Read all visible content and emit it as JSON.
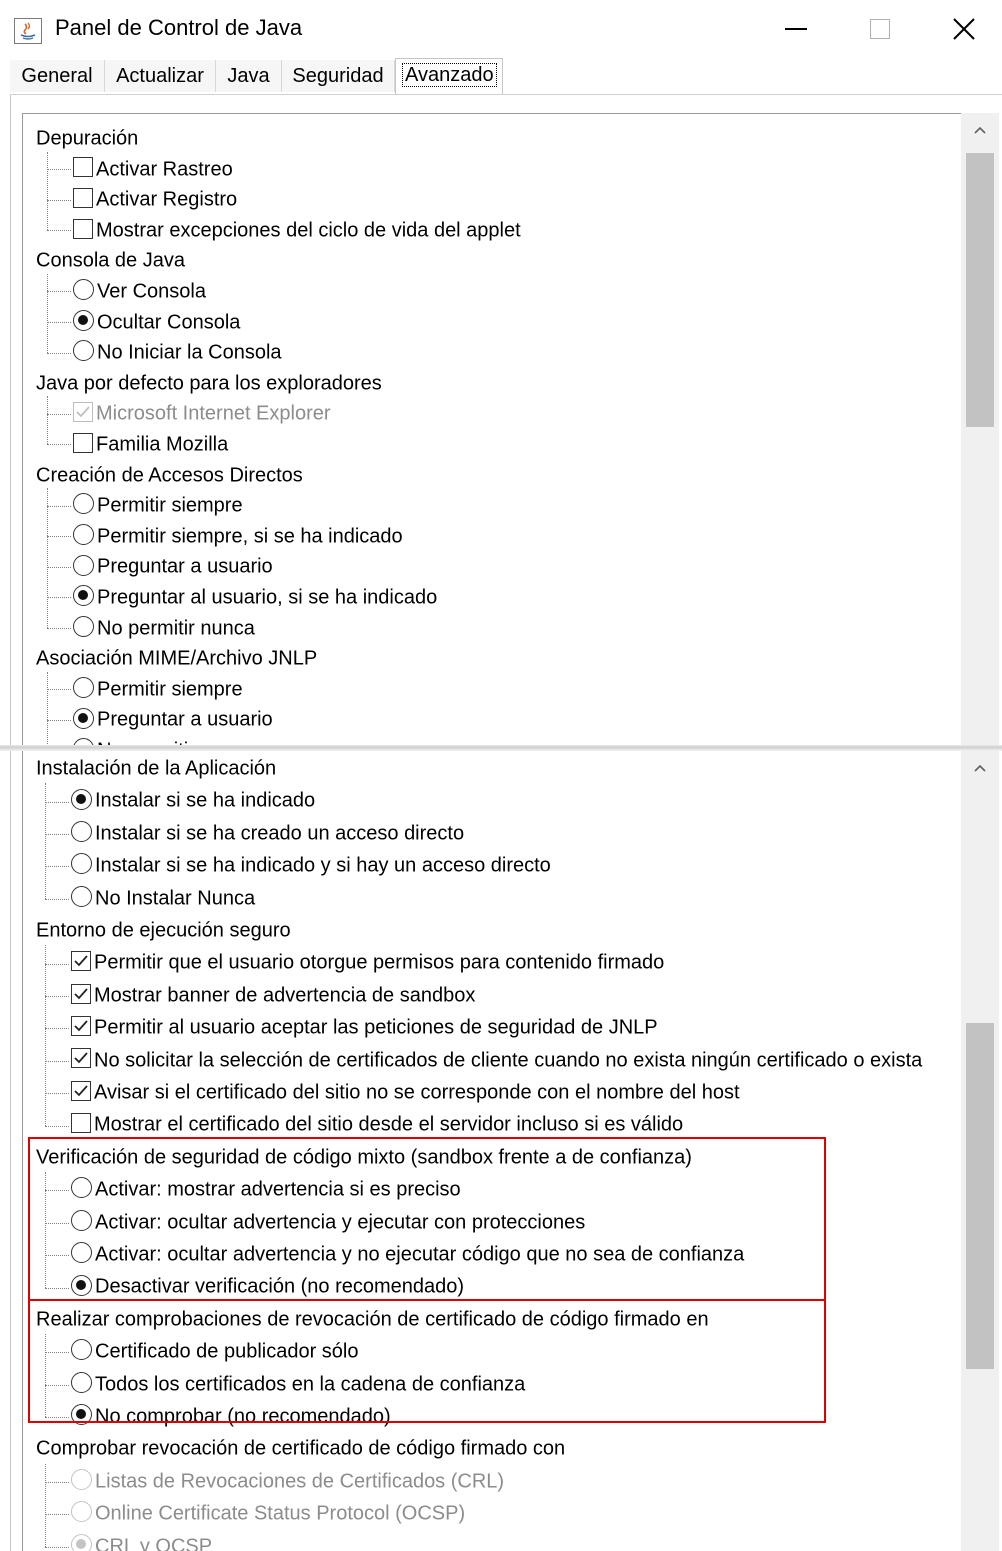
{
  "window": {
    "title": "Panel de Control de Java",
    "accent_color": "#e00000"
  },
  "tabs": [
    {
      "label": "General"
    },
    {
      "label": "Actualizar"
    },
    {
      "label": "Java"
    },
    {
      "label": "Seguridad"
    },
    {
      "label": "Avanzado"
    }
  ],
  "active_tab": "Avanzado",
  "top_panel": {
    "sections": [
      {
        "title": "Depuración",
        "items": [
          {
            "label": "Activar Rastreo",
            "type": "checkbox",
            "checked": false
          },
          {
            "label": "Activar Registro",
            "type": "checkbox",
            "checked": false
          },
          {
            "label": "Mostrar excepciones del ciclo de vida del applet",
            "type": "checkbox",
            "checked": false
          }
        ]
      },
      {
        "title": "Consola de Java",
        "items": [
          {
            "label": "Ver Consola",
            "type": "radio",
            "checked": false
          },
          {
            "label": "Ocultar Consola",
            "type": "radio",
            "checked": true
          },
          {
            "label": "No Iniciar la Consola",
            "type": "radio",
            "checked": false
          }
        ]
      },
      {
        "title": "Java por defecto para los exploradores",
        "items": [
          {
            "label": "Microsoft Internet Explorer",
            "type": "checkbox",
            "checked": true,
            "disabled": true
          },
          {
            "label": "Familia Mozilla",
            "type": "checkbox",
            "checked": false
          }
        ]
      },
      {
        "title": "Creación de Accesos Directos",
        "items": [
          {
            "label": "Permitir siempre",
            "type": "radio",
            "checked": false
          },
          {
            "label": "Permitir siempre, si se ha indicado",
            "type": "radio",
            "checked": false
          },
          {
            "label": "Preguntar a usuario",
            "type": "radio",
            "checked": false
          },
          {
            "label": "Preguntar al usuario, si se ha indicado",
            "type": "radio",
            "checked": true
          },
          {
            "label": "No permitir nunca",
            "type": "radio",
            "checked": false
          }
        ]
      },
      {
        "title": "Asociación MIME/Archivo JNLP",
        "items": [
          {
            "label": "Permitir siempre",
            "type": "radio",
            "checked": false
          },
          {
            "label": "Preguntar a usuario",
            "type": "radio",
            "checked": true
          },
          {
            "label": "No permitir nunca",
            "type": "radio",
            "checked": false
          }
        ]
      }
    ]
  },
  "bottom_panel": {
    "sections": [
      {
        "title": "Instalación de la Aplicación",
        "items": [
          {
            "label": "Instalar si se ha indicado",
            "type": "radio",
            "checked": true
          },
          {
            "label": "Instalar si se ha creado un acceso directo",
            "type": "radio",
            "checked": false
          },
          {
            "label": "Instalar si se ha indicado y si hay un acceso directo",
            "type": "radio",
            "checked": false
          },
          {
            "label": "No Instalar Nunca",
            "type": "radio",
            "checked": false
          }
        ]
      },
      {
        "title": "Entorno de ejecución seguro",
        "items": [
          {
            "label": "Permitir que el usuario otorgue permisos para contenido firmado",
            "type": "checkbox",
            "checked": true
          },
          {
            "label": "Mostrar banner de advertencia de sandbox",
            "type": "checkbox",
            "checked": true
          },
          {
            "label": "Permitir al usuario aceptar las peticiones de seguridad de JNLP",
            "type": "checkbox",
            "checked": true
          },
          {
            "label": "No solicitar la selección de certificados de cliente cuando no exista ningún certificado o exista",
            "type": "checkbox",
            "checked": true
          },
          {
            "label": "Avisar si el certificado del sitio no se corresponde con el nombre del host",
            "type": "checkbox",
            "checked": true
          },
          {
            "label": "Mostrar el certificado del sitio desde el servidor incluso si es válido",
            "type": "checkbox",
            "checked": false
          }
        ]
      },
      {
        "title": "Verificación de seguridad de código mixto (sandbox frente a de confianza)",
        "highlighted": true,
        "items": [
          {
            "label": "Activar: mostrar advertencia si es preciso",
            "type": "radio",
            "checked": false
          },
          {
            "label": "Activar: ocultar advertencia y ejecutar con protecciones",
            "type": "radio",
            "checked": false
          },
          {
            "label": "Activar: ocultar advertencia y no ejecutar código que no sea de confianza",
            "type": "radio",
            "checked": false
          },
          {
            "label": "Desactivar verificación (no recomendado)",
            "type": "radio",
            "checked": true
          }
        ]
      },
      {
        "title": "Realizar comprobaciones de revocación de certificado de código firmado en",
        "highlighted": true,
        "items": [
          {
            "label": "Certificado de publicador sólo",
            "type": "radio",
            "checked": false
          },
          {
            "label": "Todos los certificados en la cadena de confianza",
            "type": "radio",
            "checked": false
          },
          {
            "label": "No comprobar (no recomendado)",
            "type": "radio",
            "checked": true
          }
        ]
      },
      {
        "title": "Comprobar revocación de certificado de código firmado con",
        "items": [
          {
            "label": "Listas de Revocaciones de Certificados (CRL)",
            "type": "radio",
            "checked": false,
            "disabled": true
          },
          {
            "label": "Online Certificate Status Protocol (OCSP)",
            "type": "radio",
            "checked": false,
            "disabled": true
          },
          {
            "label": "CRL y OCSP",
            "type": "radio",
            "checked": true,
            "disabled": true
          }
        ]
      }
    ]
  }
}
